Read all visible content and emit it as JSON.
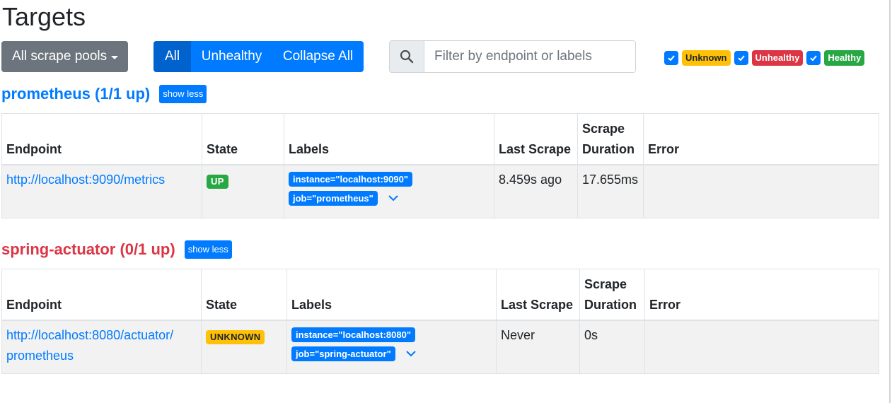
{
  "page": {
    "title": "Targets"
  },
  "toolbar": {
    "pools_dropdown": "All scrape pools",
    "filter_all": "All",
    "filter_unhealthy": "Unhealthy",
    "collapse_all": "Collapse All",
    "search_placeholder": "Filter by endpoint or labels"
  },
  "health_filters": [
    {
      "label": "Unknown",
      "checked": true,
      "color": "#ffc107"
    },
    {
      "label": "Unhealthy",
      "checked": true,
      "color": "#dc3545"
    },
    {
      "label": "Healthy",
      "checked": true,
      "color": "#28a745"
    }
  ],
  "columns": [
    "Endpoint",
    "State",
    "Labels",
    "Last Scrape",
    "Scrape Duration",
    "Error"
  ],
  "pools": [
    {
      "title": "prometheus (1/1 up)",
      "toggle": "show less",
      "targets": [
        {
          "endpoint": "http://localhost:9090/metrics",
          "state": "UP",
          "labels": [
            "instance=\"localhost:9090\"",
            "job=\"prometheus\""
          ],
          "last_scrape": "8.459s ago",
          "duration": "17.655ms",
          "error": ""
        }
      ]
    },
    {
      "title": "spring-actuator (0/1 up)",
      "toggle": "show less",
      "targets": [
        {
          "endpoint_line1": "http://localhost:8080/actuator/",
          "endpoint_line2": "prometheus",
          "state": "UNKNOWN",
          "labels": [
            "instance=\"localhost:8080\"",
            "job=\"spring-actuator\""
          ],
          "last_scrape": "Never",
          "duration": "0s",
          "error": ""
        }
      ]
    }
  ]
}
